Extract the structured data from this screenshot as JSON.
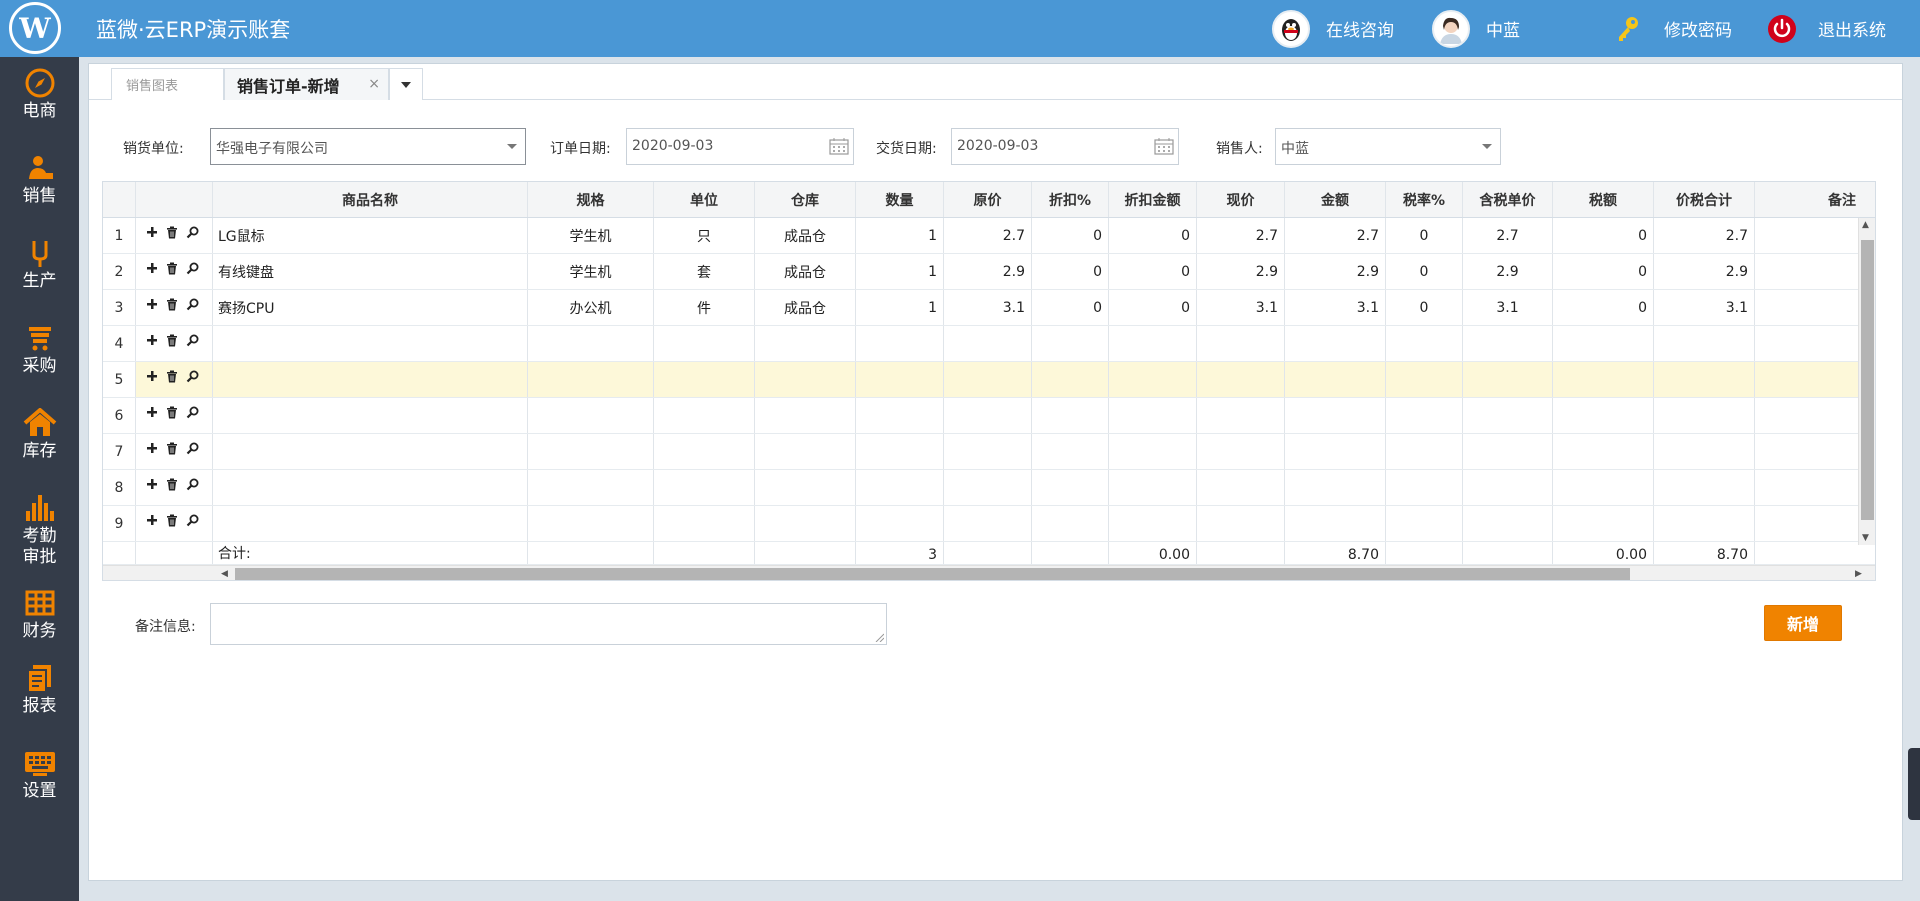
{
  "header": {
    "logo_text": "W",
    "app_title": "蓝微·云ERP演示账套",
    "online_consult": "在线咨询",
    "user_name": "中蓝",
    "change_password": "修改密码",
    "logout": "退出系统"
  },
  "sidebar": {
    "items": [
      {
        "label": "电商",
        "icon": "compass-icon"
      },
      {
        "label": "销售",
        "icon": "salesperson-icon"
      },
      {
        "label": "生产",
        "icon": "production-icon"
      },
      {
        "label": "采购",
        "icon": "cart-icon"
      },
      {
        "label": "库存",
        "icon": "home-icon"
      },
      {
        "label": "考勤\n审批",
        "label1": "考勤",
        "label2": "审批",
        "icon": "signal-bars-icon"
      },
      {
        "label": "财务",
        "icon": "grid-icon"
      },
      {
        "label": "报表",
        "icon": "report-icon"
      },
      {
        "label": "设置",
        "icon": "keyboard-icon"
      }
    ]
  },
  "tabs": {
    "inactive": "销售图表",
    "active": "销售订单-新增",
    "close": "×"
  },
  "form": {
    "customer_label": "销货单位:",
    "customer_value": "华强电子有限公司",
    "order_date_label": "订单日期:",
    "order_date_value": "2020-09-03",
    "delivery_date_label": "交货日期:",
    "delivery_date_value": "2020-09-03",
    "salesperson_label": "销售人:",
    "salesperson_value": "中蓝"
  },
  "grid": {
    "columns": [
      "商品名称",
      "规格",
      "单位",
      "仓库",
      "数量",
      "原价",
      "折扣%",
      "折扣金额",
      "现价",
      "金额",
      "税率%",
      "含税单价",
      "税额",
      "价税合计",
      "备注"
    ],
    "rows": [
      {
        "num": "1",
        "cells": [
          "LG鼠标",
          "学生机",
          "只",
          "成品仓",
          "1",
          "2.7",
          "0",
          "0",
          "2.7",
          "2.7",
          "0",
          "2.7",
          "0",
          "2.7",
          ""
        ]
      },
      {
        "num": "2",
        "cells": [
          "有线键盘",
          "学生机",
          "套",
          "成品仓",
          "1",
          "2.9",
          "0",
          "0",
          "2.9",
          "2.9",
          "0",
          "2.9",
          "0",
          "2.9",
          ""
        ]
      },
      {
        "num": "3",
        "cells": [
          "赛扬CPU",
          "办公机",
          "件",
          "成品仓",
          "1",
          "3.1",
          "0",
          "0",
          "3.1",
          "3.1",
          "0",
          "3.1",
          "0",
          "3.1",
          ""
        ]
      },
      {
        "num": "4",
        "cells": [
          "",
          "",
          "",
          "",
          "",
          "",
          "",
          "",
          "",
          "",
          "",
          "",
          "",
          "",
          ""
        ]
      },
      {
        "num": "5",
        "cells": [
          "",
          "",
          "",
          "",
          "",
          "",
          "",
          "",
          "",
          "",
          "",
          "",
          "",
          "",
          ""
        ],
        "highlight": true
      },
      {
        "num": "6",
        "cells": [
          "",
          "",
          "",
          "",
          "",
          "",
          "",
          "",
          "",
          "",
          "",
          "",
          "",
          "",
          ""
        ]
      },
      {
        "num": "7",
        "cells": [
          "",
          "",
          "",
          "",
          "",
          "",
          "",
          "",
          "",
          "",
          "",
          "",
          "",
          "",
          ""
        ]
      },
      {
        "num": "8",
        "cells": [
          "",
          "",
          "",
          "",
          "",
          "",
          "",
          "",
          "",
          "",
          "",
          "",
          "",
          "",
          ""
        ]
      },
      {
        "num": "9",
        "cells": [
          "",
          "",
          "",
          "",
          "",
          "",
          "",
          "",
          "",
          "",
          "",
          "",
          "",
          "",
          ""
        ]
      }
    ],
    "totals": {
      "label": "合计:",
      "quantity": "3",
      "discount_amount": "0.00",
      "amount": "8.70",
      "tax": "0.00",
      "total": "8.70"
    }
  },
  "remark_label": "备注信息:",
  "add_button": "新增",
  "colors": {
    "header_bg": "#4a97d5",
    "sidebar_bg": "#343c49",
    "accent_orange": "#f08300",
    "row_highlight": "#fdf8d9"
  }
}
